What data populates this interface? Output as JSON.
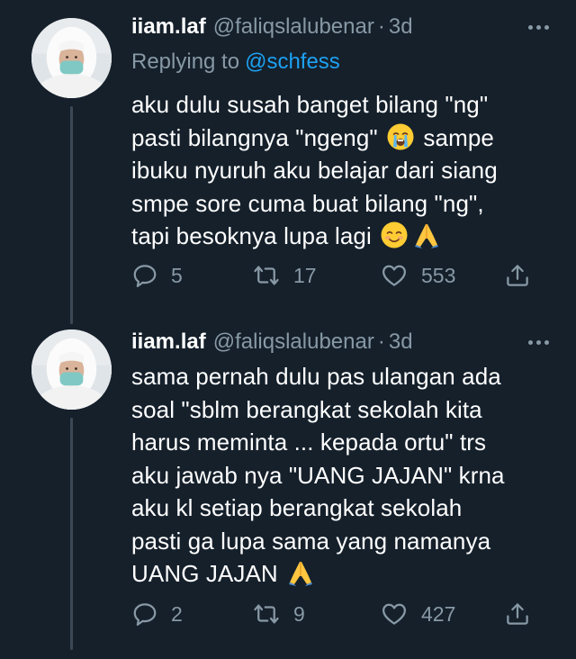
{
  "tweets": [
    {
      "display_name": "iiam.laf",
      "handle": "@faliqslalubenar",
      "separator": "·",
      "time": "3d",
      "replying_label": "Replying to",
      "replying_to": "@schfess",
      "body_lines": [
        "aku dulu susah banget bilang \"ng\"",
        "pasti bilangnya \"ngeng\"",
        "sampe",
        "ibuku nyuruh aku belajar dari siang",
        "smpe sore cuma buat bilang \"ng\",",
        "tapi besoknya lupa lagi"
      ],
      "emojis": [
        "crying-face",
        "smiling-face",
        "folded-hands"
      ],
      "stats": {
        "replies": "5",
        "retweets": "17",
        "likes": "553"
      },
      "icons": [
        "reply-icon",
        "retweet-icon",
        "heart-icon",
        "share-icon",
        "more-icon"
      ]
    },
    {
      "display_name": "iiam.laf",
      "handle": "@faliqslalubenar",
      "separator": "·",
      "time": "3d",
      "body_lines": [
        "sama pernah dulu pas ulangan ada",
        "soal \"sblm berangkat sekolah kita",
        "harus meminta ... kepada ortu\" trs",
        "aku jawab nya \"UANG JAJAN\" krna",
        "aku kl setiap berangkat sekolah",
        "pasti ga lupa sama yang namanya",
        "UANG JAJAN"
      ],
      "emojis": [
        "folded-hands"
      ],
      "stats": {
        "replies": "2",
        "retweets": "9",
        "likes": "427"
      },
      "icons": [
        "reply-icon",
        "retweet-icon",
        "heart-icon",
        "share-icon",
        "more-icon"
      ]
    }
  ],
  "colors": {
    "background": "#15202b",
    "text": "#ffffff",
    "muted": "#8899a6",
    "link": "#1da1f2",
    "thread_line": "#3b4956"
  }
}
